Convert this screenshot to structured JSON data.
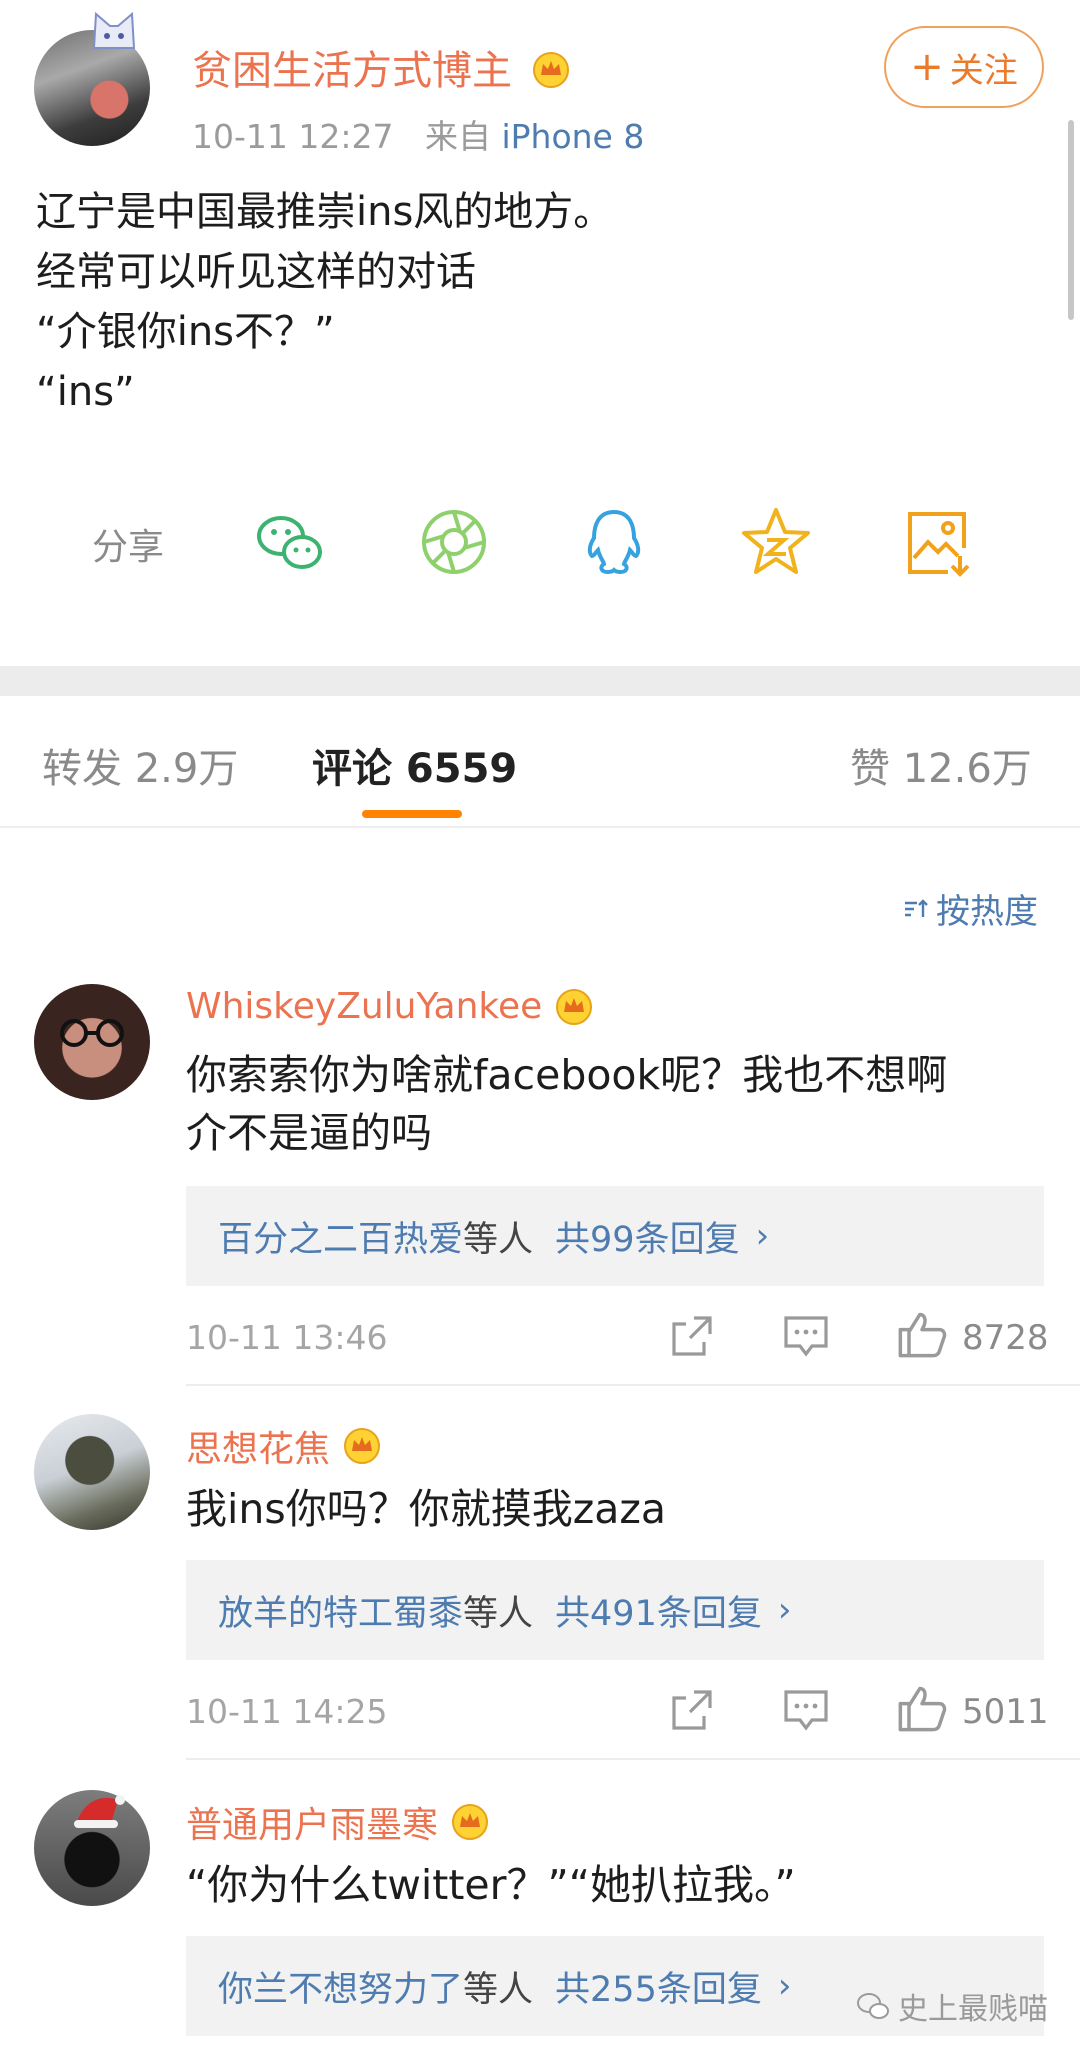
{
  "post": {
    "author": "贫困生活方式博主",
    "time": "10-11 12:27",
    "source_prefix": "来自",
    "source": "iPhone 8",
    "follow_label": "关注",
    "text": "辽宁是中国最推崇ins风的地方。\n经常可以听见这样的对话\n“介银你ins不？”\n“ins”"
  },
  "share": {
    "label": "分享",
    "targets": [
      "wechat-icon",
      "moments-icon",
      "qq-icon",
      "qzone-icon",
      "save-image-icon"
    ]
  },
  "tabs": [
    {
      "label": "转发 2.9万"
    },
    {
      "label": "评论 6559"
    },
    {
      "label": "赞 12.6万"
    }
  ],
  "sort_label": "按热度",
  "comments": [
    {
      "name": "WhiskeyZuluYankee",
      "text": "你索索你为啥就facebook呢？我也不想啊\n介不是逼的吗",
      "reply_user": "百分之二百热爱",
      "reply_mid": "等人",
      "reply_count": "共99条回复",
      "time": "10-11 13:46",
      "likes": "8728"
    },
    {
      "name": "思想花焦",
      "text": "我ins你吗？你就摸我zaza",
      "reply_user": "放羊的特工蜀黍",
      "reply_mid": "等人",
      "reply_count": "共491条回复",
      "time": "10-11 14:25",
      "likes": "5011"
    },
    {
      "name": "普通用户雨墨寒",
      "text": "“你为什么twitter？”“她扒拉我。”",
      "reply_user": "你兰不想努力了",
      "reply_mid": "等人",
      "reply_count": "共255条回复"
    }
  ],
  "watermark": "史上最贱喵",
  "colors": {
    "accent_orange": "#eb7350",
    "link_blue": "#4e7cb0",
    "tab_indicator": "#ff8200"
  }
}
